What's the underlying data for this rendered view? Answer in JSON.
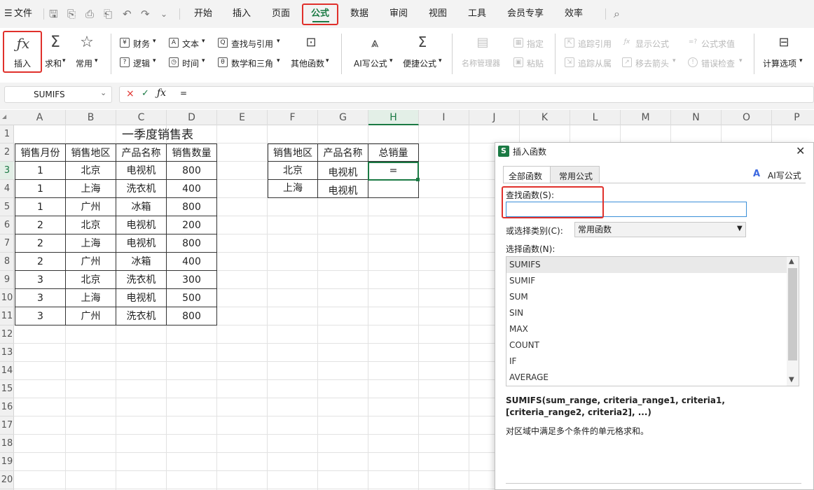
{
  "menubar": {
    "file": "文件",
    "tabs": [
      "开始",
      "插入",
      "页面",
      "公式",
      "数据",
      "审阅",
      "视图",
      "工具",
      "会员专享",
      "效率"
    ],
    "active_tab": "公式"
  },
  "ribbon": {
    "insert_label": "插入",
    "sum_label": "求和",
    "common_label": "常用",
    "finance": "财务",
    "text": "文本",
    "lookup": "查找与引用",
    "logic": "逻辑",
    "time": "时间",
    "math": "数学和三角",
    "other": "其他函数",
    "ai_formula": "AI写公式",
    "quick_formula": "便捷公式",
    "name_manager": "名称管理器",
    "define": "指定",
    "paste": "粘贴",
    "trace_prec": "追踪引用",
    "show_formula": "显示公式",
    "formula_eval": "公式求值",
    "trace_dep": "追踪从属",
    "remove_arrows": "移去箭头",
    "error_check": "错误检查",
    "calc_options": "计算选项"
  },
  "formula_bar": {
    "name_box": "SUMIFS",
    "content": "="
  },
  "columns": [
    "A",
    "B",
    "C",
    "D",
    "E",
    "F",
    "G",
    "H",
    "I",
    "J",
    "K",
    "L",
    "M",
    "N",
    "O",
    "P"
  ],
  "rows": [
    "1",
    "2",
    "3",
    "4",
    "5",
    "6",
    "7",
    "8",
    "9",
    "10",
    "11",
    "12",
    "13",
    "14",
    "15",
    "16",
    "17",
    "18",
    "19",
    "20"
  ],
  "sheet": {
    "title": "一季度销售表",
    "headers": [
      "销售月份",
      "销售地区",
      "产品名称",
      "销售数量"
    ],
    "data": [
      [
        "1",
        "北京",
        "电视机",
        "800"
      ],
      [
        "1",
        "上海",
        "洗衣机",
        "400"
      ],
      [
        "1",
        "广州",
        "冰箱",
        "800"
      ],
      [
        "2",
        "北京",
        "电视机",
        "200"
      ],
      [
        "2",
        "上海",
        "电视机",
        "800"
      ],
      [
        "2",
        "广州",
        "冰箱",
        "400"
      ],
      [
        "3",
        "北京",
        "洗衣机",
        "300"
      ],
      [
        "3",
        "上海",
        "电视机",
        "500"
      ],
      [
        "3",
        "广州",
        "洗衣机",
        "800"
      ]
    ],
    "summary_headers": [
      "销售地区",
      "产品名称",
      "总销量"
    ],
    "summary_rows": [
      [
        "北京",
        "电视机",
        "="
      ],
      [
        "上海",
        "电视机",
        ""
      ]
    ]
  },
  "dialog": {
    "title": "插入函数",
    "tab_all": "全部函数",
    "tab_common": "常用公式",
    "ai_write": "AI写公式",
    "search_label": "查找函数(S):",
    "search_value": "",
    "category_label": "或选择类别(C):",
    "category_value": "常用函数",
    "function_label": "选择函数(N):",
    "functions": [
      "SUMIFS",
      "SUMIF",
      "SUM",
      "SIN",
      "MAX",
      "COUNT",
      "IF",
      "AVERAGE"
    ],
    "selected_function": "SUMIFS",
    "signature": "SUMIFS(sum_range, criteria_range1, criteria1, [criteria_range2, criteria2], ...)",
    "description": "对区域中满足多个条件的单元格求和。"
  }
}
